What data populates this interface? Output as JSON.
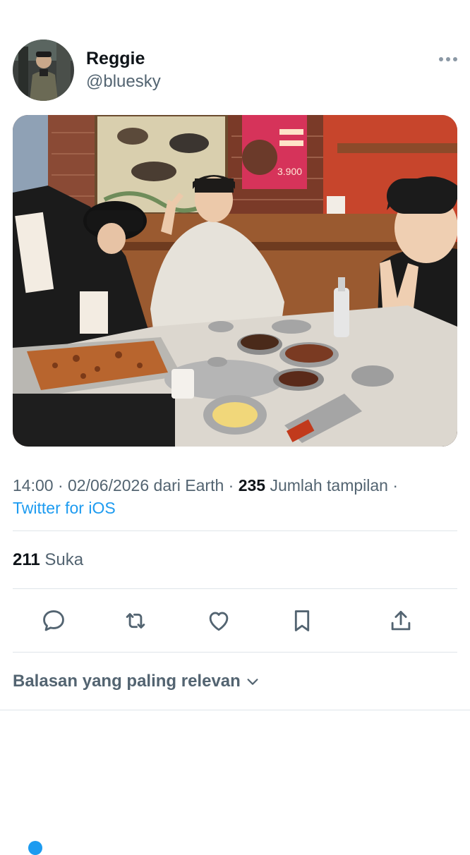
{
  "author": {
    "display_name": "Reggie",
    "handle": "@bluesky"
  },
  "meta": {
    "time": "14:00",
    "date": "02/06/2026",
    "location_prefix": "dari",
    "location": "Earth",
    "views_count": "235",
    "views_label": "Jumlah tampilan",
    "separator": "·",
    "source": "Twitter for iOS"
  },
  "stats": {
    "likes_count": "211",
    "likes_label": "Suka"
  },
  "replies": {
    "sort_label": "Balasan yang paling relevan"
  },
  "photo": {
    "poster_text_1": "3.900",
    "poster_text_2": "3.900"
  },
  "colors": {
    "accent": "#1d9bf0",
    "text_primary": "#0f1419",
    "text_secondary": "#536471",
    "divider": "#dfe5e9"
  },
  "icons": [
    "more-icon",
    "reply-icon",
    "retweet-icon",
    "like-icon",
    "bookmark-icon",
    "share-icon",
    "chevron-down-icon"
  ]
}
